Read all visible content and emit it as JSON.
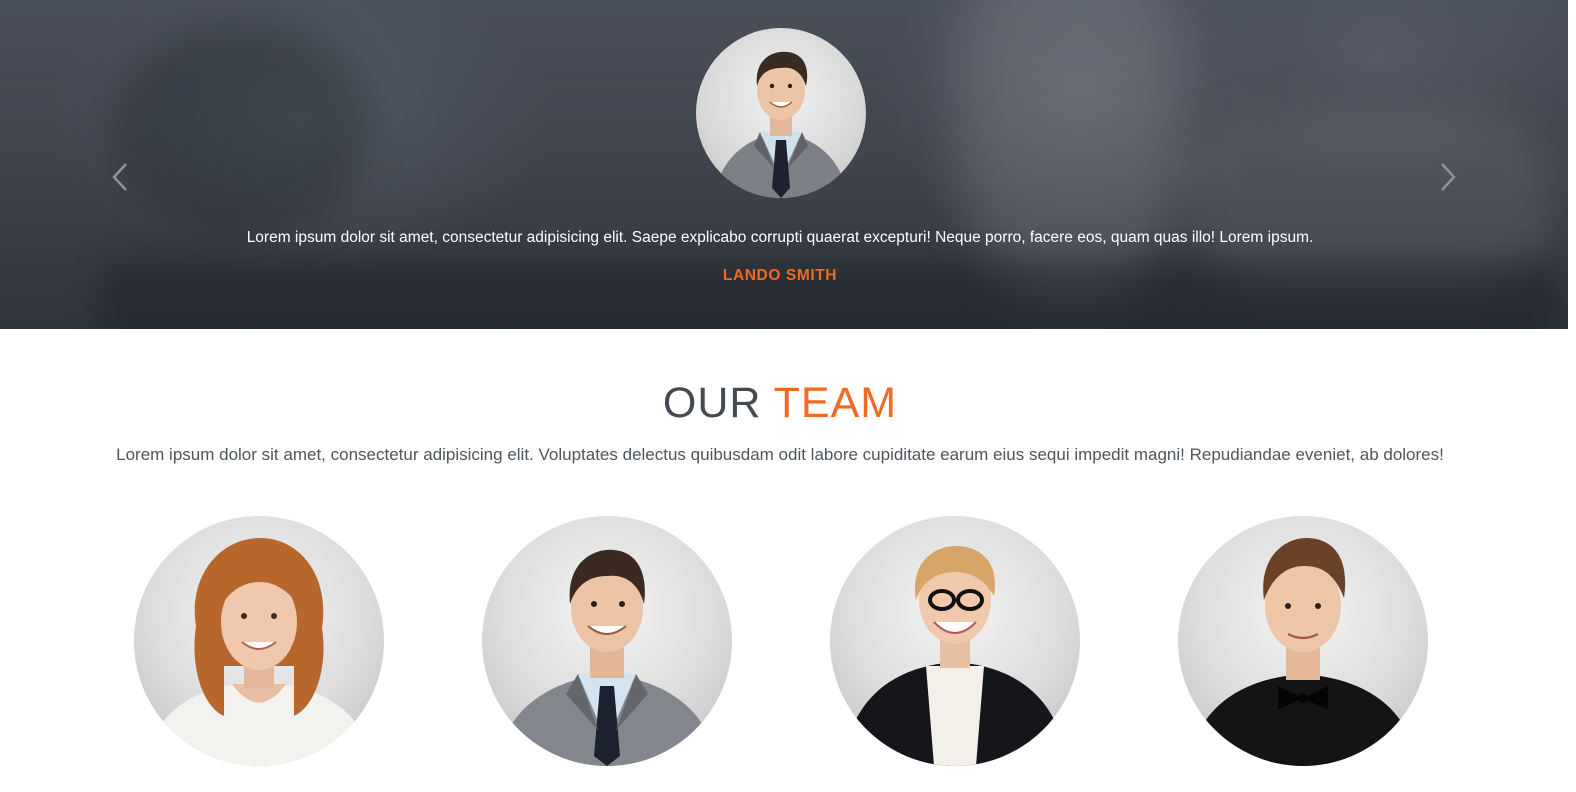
{
  "theme": {
    "accent": "#f06a22",
    "dark_text": "#444a52",
    "hero_overlay": "#3d424b"
  },
  "testimonial": {
    "quote": "Lorem ipsum dolor sit amet, consectetur adipisicing elit. Saepe explicabo corrupti quaerat excepturi! Neque porro, facere eos, quam quas illo! Lorem ipsum.",
    "author": "LANDO SMITH",
    "prev_icon": "chevron-left-icon",
    "next_icon": "chevron-right-icon"
  },
  "team": {
    "title_part1": "OUR",
    "title_part2": "TEAM",
    "description": "Lorem ipsum dolor sit amet, consectetur adipisicing elit. Voluptates delectus quibusdam odit labore cupiditate earum eius sequi impedit magni! Repudiandae eveniet, ab dolores!",
    "members": [
      {
        "photo": "woman-curly-hair-portrait"
      },
      {
        "photo": "man-gray-suit-portrait"
      },
      {
        "photo": "woman-glasses-portrait"
      },
      {
        "photo": "young-man-bowtie-portrait"
      }
    ]
  }
}
